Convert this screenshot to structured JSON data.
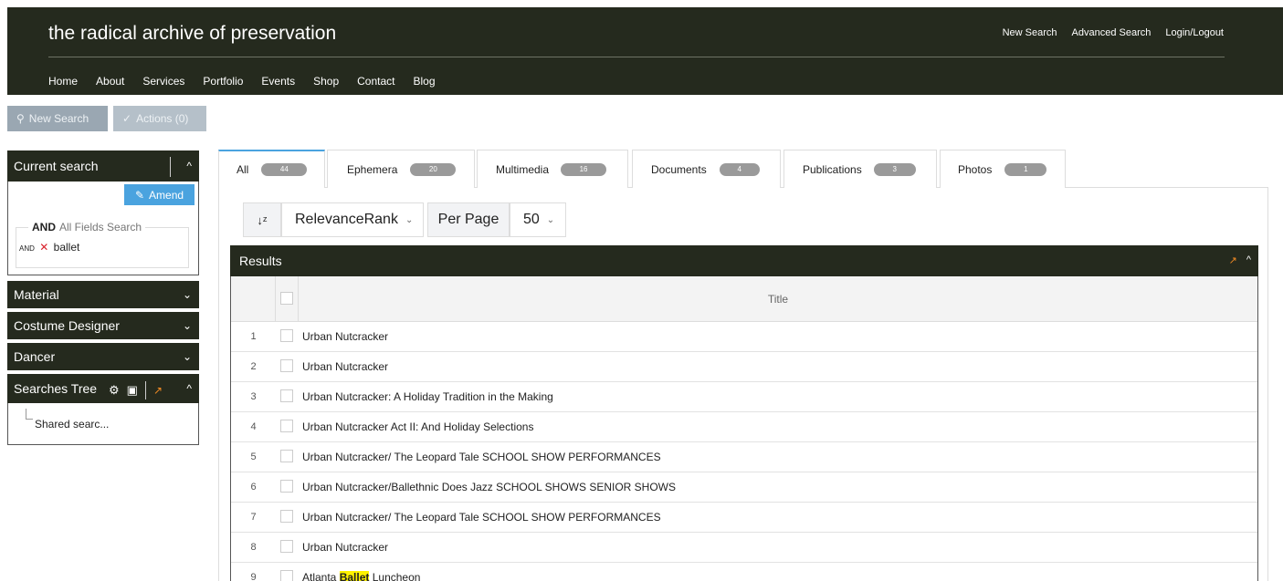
{
  "header": {
    "site_title": "the radical archive of preservation",
    "top_links": [
      "New Search",
      "Advanced Search",
      "Login/Logout"
    ],
    "nav": [
      "Home",
      "About",
      "Services",
      "Portfolio",
      "Events",
      "Shop",
      "Contact",
      "Blog"
    ]
  },
  "toolbar": {
    "new_search": "New Search",
    "actions": "Actions (0)"
  },
  "sidebar": {
    "current_search": {
      "title": "Current search",
      "amend": "Amend",
      "group_operator": "AND",
      "group_label": "All Fields Search",
      "term_operator": "AND",
      "term": "ballet"
    },
    "facets": [
      "Material",
      "Costume Designer",
      "Dancer"
    ],
    "searches_tree": {
      "title": "Searches Tree",
      "item": "Shared searc..."
    }
  },
  "tabs": [
    {
      "label": "All",
      "count": "44"
    },
    {
      "label": "Ephemera",
      "count": "20"
    },
    {
      "label": "Multimedia",
      "count": "16"
    },
    {
      "label": "Documents",
      "count": "4"
    },
    {
      "label": "Publications",
      "count": "3"
    },
    {
      "label": "Photos",
      "count": "1"
    }
  ],
  "controls": {
    "sort_value": "RelevanceRank",
    "per_page_label": "Per Page",
    "per_page_value": "50"
  },
  "results": {
    "title": "Results",
    "column_title": "Title",
    "rows": [
      {
        "n": "1",
        "title": "Urban Nutcracker"
      },
      {
        "n": "2",
        "title": "Urban Nutcracker"
      },
      {
        "n": "3",
        "title": "Urban Nutcracker: A Holiday Tradition in the Making"
      },
      {
        "n": "4",
        "title": "Urban Nutcracker Act II: And Holiday Selections"
      },
      {
        "n": "5",
        "title": "Urban Nutcracker/ The Leopard Tale SCHOOL SHOW PERFORMANCES"
      },
      {
        "n": "6",
        "title": "Urban Nutcracker/Ballethnic Does Jazz SCHOOL SHOWS SENIOR SHOWS"
      },
      {
        "n": "7",
        "title": "Urban Nutcracker/ The Leopard Tale SCHOOL SHOW PERFORMANCES"
      },
      {
        "n": "8",
        "title": "Urban Nutcracker"
      },
      {
        "n": "9",
        "title_pre": "Atlanta ",
        "title_hl": "Ballet",
        "title_post": " Luncheon"
      }
    ]
  },
  "colors": {
    "header_bg": "#252a1e",
    "accent": "#4aa3df",
    "expand": "#f08a24",
    "highlight": "#fff200"
  }
}
